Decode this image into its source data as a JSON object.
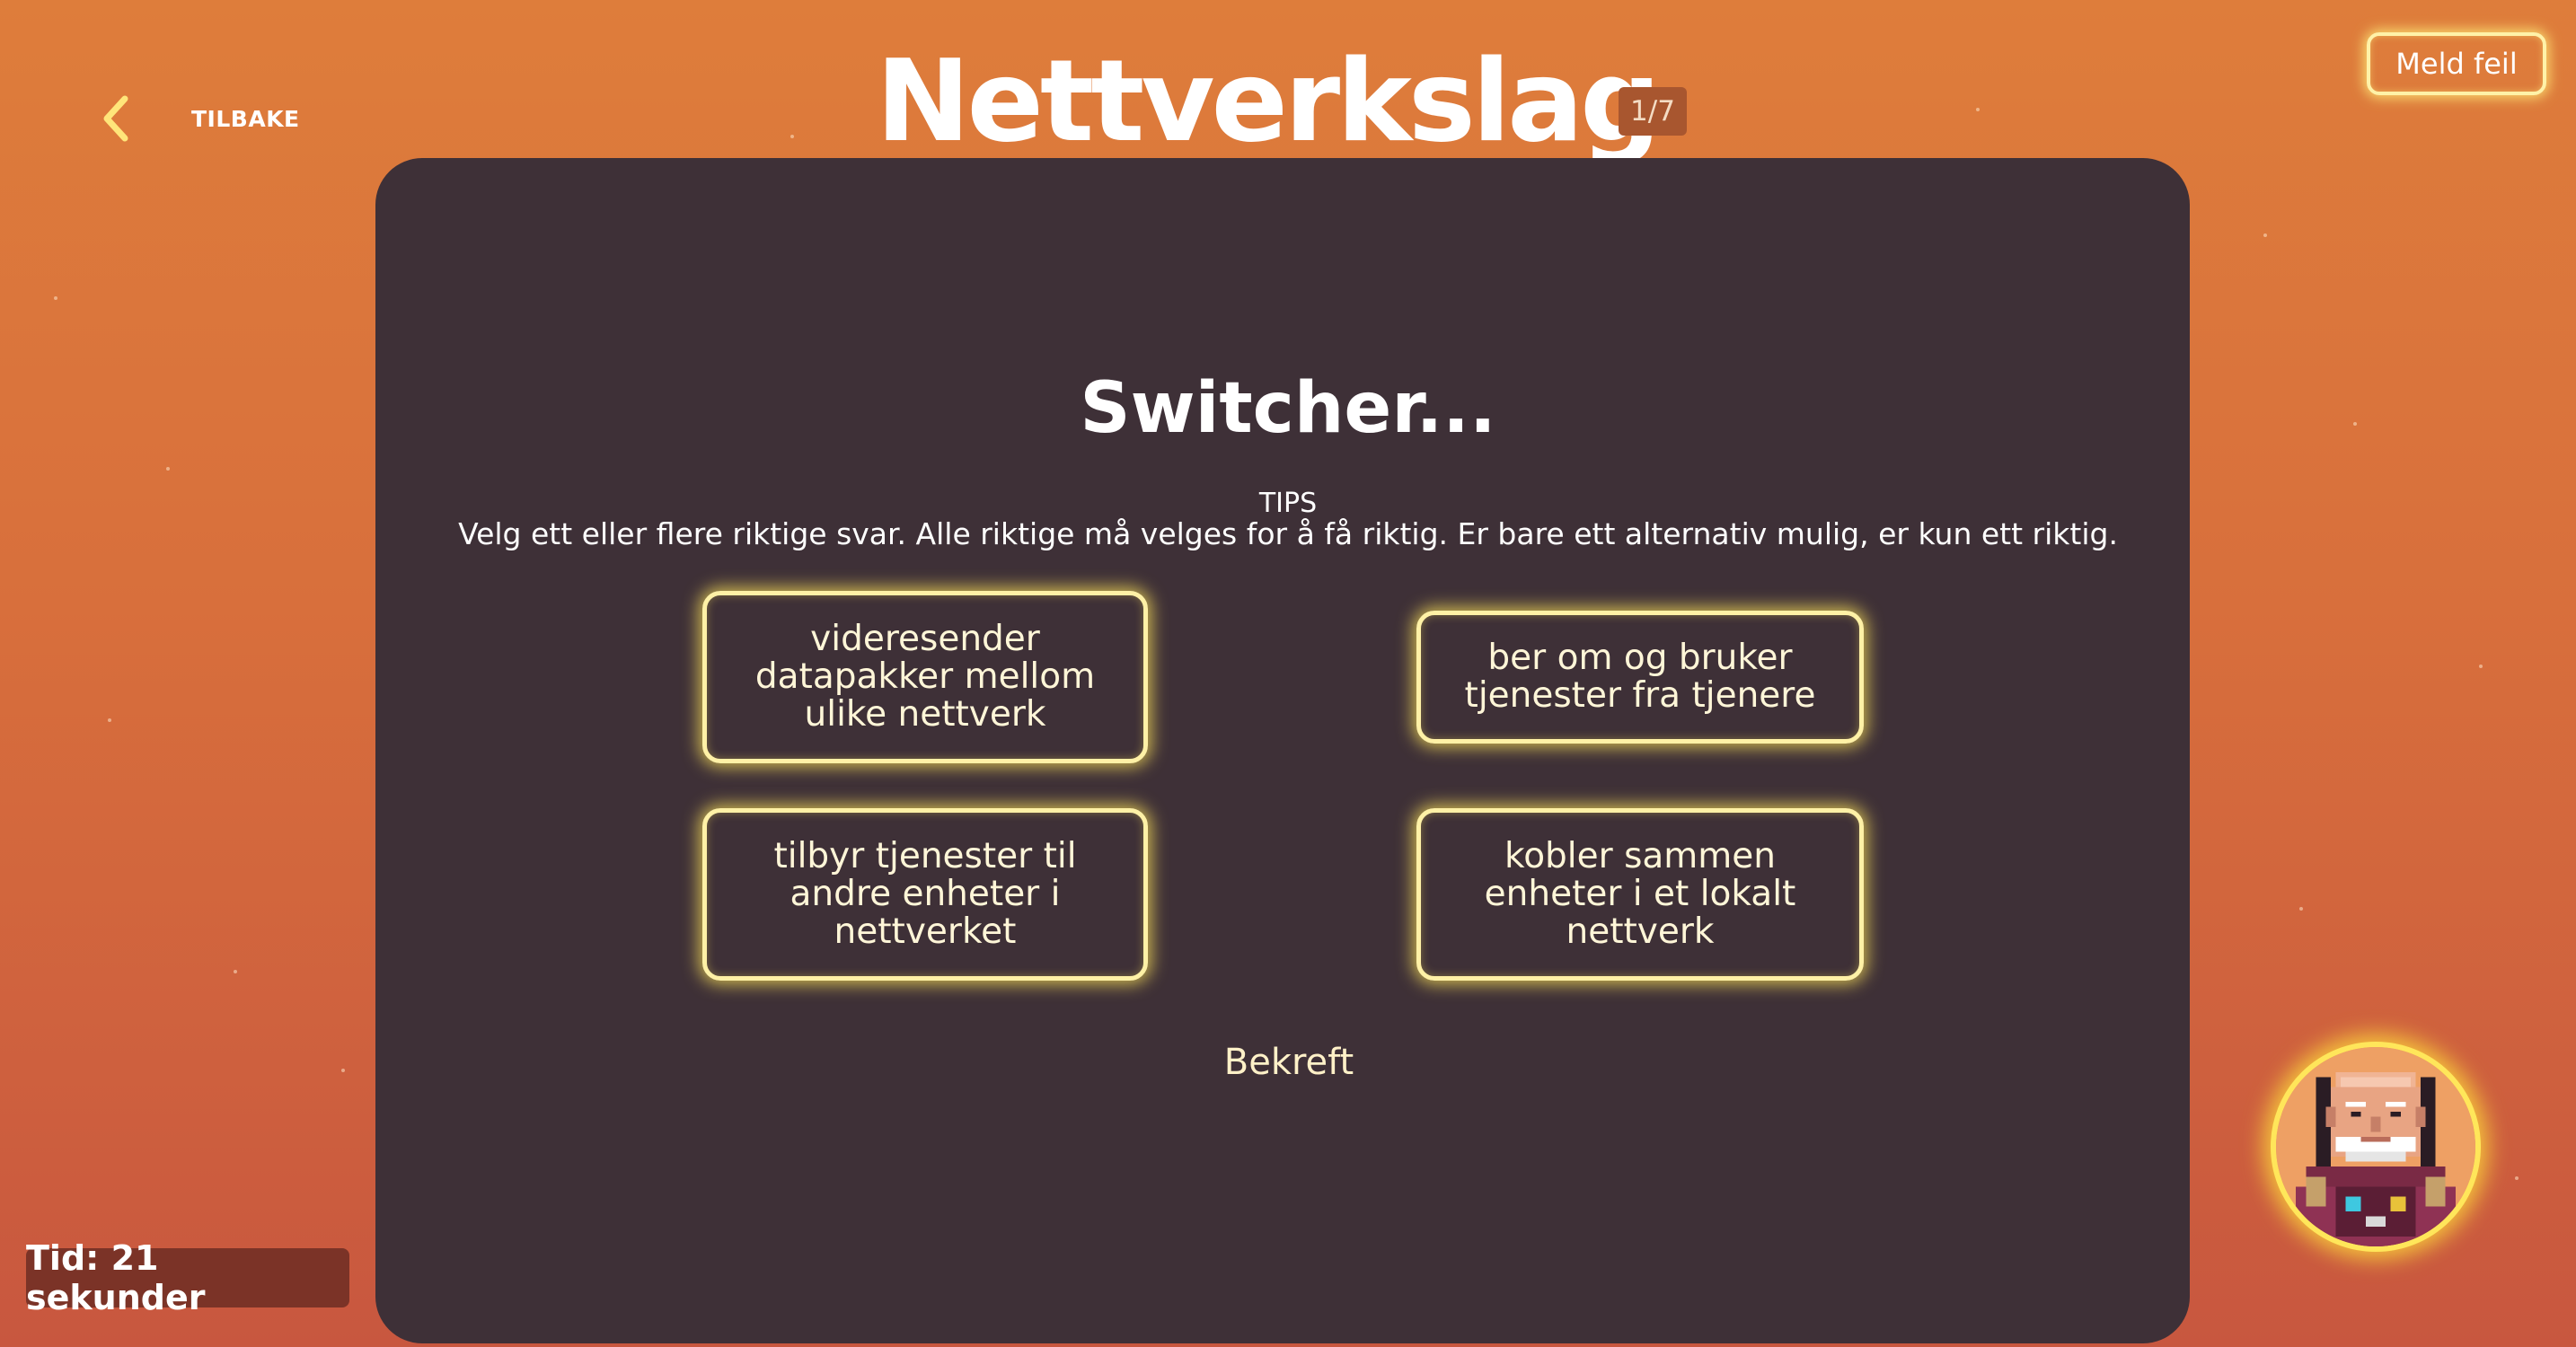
{
  "nav": {
    "back_label": "TILBAKE",
    "back_icon": "chevron-left-icon"
  },
  "header": {
    "title": "Nettverkslag",
    "progress": "1/7",
    "report_label": "Meld feil"
  },
  "quiz": {
    "question": "Switcher...",
    "tips_heading": "TIPS",
    "tips_text": "Velg ett eller flere riktige svar. Alle riktige må velges for å få riktig. Er bare ett alternativ mulig, er kun ett riktig.",
    "options": [
      "videresender datapakker mellom ulike nettverk",
      "ber om og bruker tjenester fra tjenere",
      "tilbyr tjenester til andre enheter i nettverket",
      "kobler sammen enheter i et lokalt nettverk"
    ],
    "confirm_label": "Bekreft"
  },
  "timer": {
    "label": "Tid: 21 sekunder"
  },
  "avatar": {
    "icon": "astronaut-avatar-icon"
  },
  "colors": {
    "background_top": "#de7d3b",
    "background_bottom": "#c8573f",
    "panel": "#3e3037",
    "neon_border": "#fff1a6",
    "timer_bg": "#7b3327",
    "badge_bg": "#a8562f"
  }
}
